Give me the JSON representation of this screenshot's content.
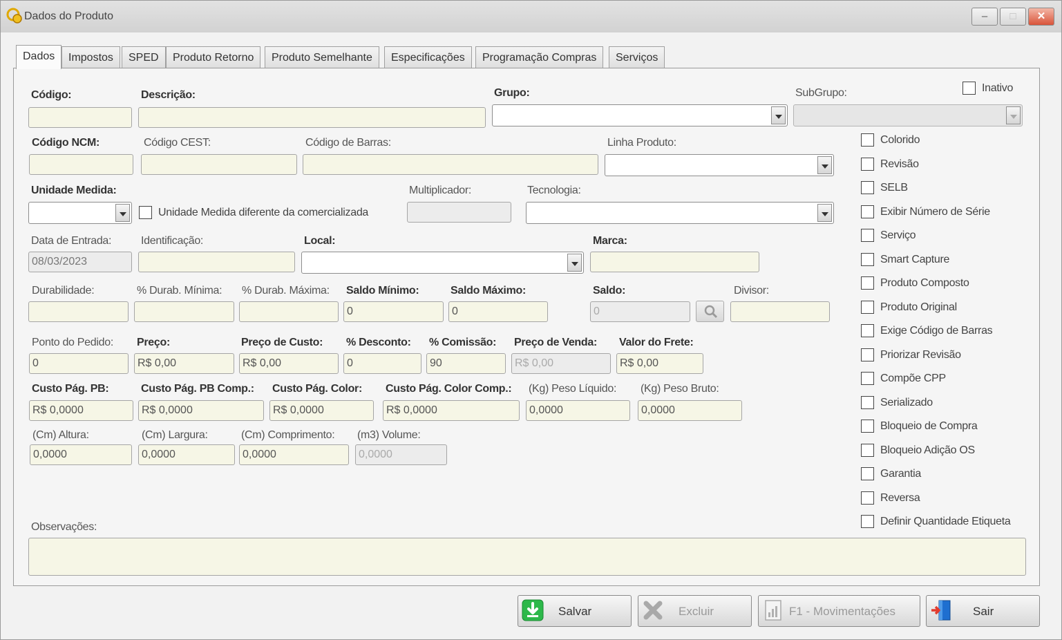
{
  "window": {
    "title": "Dados do Produto",
    "minimize": "–",
    "maximize": "□",
    "close": "✕"
  },
  "tabs": [
    "Dados",
    "Impostos",
    "SPED",
    "Produto Retorno",
    "Produto Semelhante",
    "Especificações",
    "Programação Compras",
    "Serviços"
  ],
  "form": {
    "codigo": {
      "label": "Código:",
      "value": ""
    },
    "descricao": {
      "label": "Descrição:",
      "value": ""
    },
    "grupo": {
      "label": "Grupo:",
      "value": ""
    },
    "subgrupo": {
      "label": "SubGrupo:",
      "value": ""
    },
    "inativo": {
      "label": "Inativo",
      "checked": false
    },
    "codigo_ncm": {
      "label": "Código NCM:",
      "value": ""
    },
    "codigo_cest": {
      "label": "Código CEST:",
      "value": ""
    },
    "codigo_barras": {
      "label": "Código de Barras:",
      "value": ""
    },
    "linha_produto": {
      "label": "Linha Produto:",
      "value": ""
    },
    "unidade_medida": {
      "label": "Unidade Medida:",
      "value": ""
    },
    "unidade_diferente": {
      "label": "Unidade Medida diferente da comercializada",
      "checked": false
    },
    "multiplicador": {
      "label": "Multiplicador:",
      "value": ""
    },
    "tecnologia": {
      "label": "Tecnologia:",
      "value": ""
    },
    "data_entrada": {
      "label": "Data de Entrada:",
      "value": "08/03/2023"
    },
    "identificacao": {
      "label": "Identificação:",
      "value": ""
    },
    "local": {
      "label": "Local:",
      "value": ""
    },
    "marca": {
      "label": "Marca:",
      "value": ""
    },
    "durabilidade": {
      "label": "Durabilidade:",
      "value": ""
    },
    "durab_minima": {
      "label": "% Durab. Mínima:",
      "value": ""
    },
    "durab_maxima": {
      "label": "% Durab. Máxima:",
      "value": ""
    },
    "saldo_minimo": {
      "label": "Saldo Mínimo:",
      "value": "0"
    },
    "saldo_maximo": {
      "label": "Saldo Máximo:",
      "value": "0"
    },
    "saldo": {
      "label": "Saldo:",
      "value": "0"
    },
    "divisor": {
      "label": "Divisor:",
      "value": ""
    },
    "ponto_pedido": {
      "label": "Ponto do Pedido:",
      "value": "0"
    },
    "preco": {
      "label": "Preço:",
      "value": "R$ 0,00"
    },
    "preco_custo": {
      "label": "Preço de Custo:",
      "value": "R$ 0,00"
    },
    "desconto": {
      "label": "% Desconto:",
      "value": "0"
    },
    "comissao": {
      "label": "% Comissão:",
      "value": "90"
    },
    "preco_venda": {
      "label": "Preço de Venda:",
      "value": "R$ 0,00"
    },
    "valor_frete": {
      "label": "Valor do Frete:",
      "value": "R$ 0,00"
    },
    "custo_pb": {
      "label": "Custo Pág. PB:",
      "value": "R$ 0,0000"
    },
    "custo_pb_comp": {
      "label": "Custo Pág. PB Comp.:",
      "value": "R$ 0,0000"
    },
    "custo_color": {
      "label": "Custo Pág. Color:",
      "value": "R$ 0,0000"
    },
    "custo_color_comp": {
      "label": "Custo Pág. Color Comp.:",
      "value": "R$ 0,0000"
    },
    "peso_liquido": {
      "label": "(Kg) Peso Líquido:",
      "value": "0,0000"
    },
    "peso_bruto": {
      "label": "(Kg) Peso Bruto:",
      "value": "0,0000"
    },
    "altura": {
      "label": "(Cm) Altura:",
      "value": "0,0000"
    },
    "largura": {
      "label": "(Cm) Largura:",
      "value": "0,0000"
    },
    "comprimento": {
      "label": "(Cm) Comprimento:",
      "value": "0,0000"
    },
    "volume": {
      "label": "(m3) Volume:",
      "value": "0,0000"
    },
    "observacoes": {
      "label": "Observações:",
      "value": ""
    }
  },
  "options": [
    "Colorido",
    "Revisão",
    "SELB",
    "Exibir Número de Série",
    "Serviço",
    "Smart Capture",
    "Produto Composto",
    "Produto Original",
    "Exige Código de Barras",
    "Priorizar Revisão",
    "Compõe CPP",
    "Serializado",
    "Bloqueio de Compra",
    "Bloqueio Adição OS",
    "Garantia",
    "Reversa",
    "Definir Quantidade Etiqueta"
  ],
  "buttons": {
    "salvar": "Salvar",
    "excluir": "Excluir",
    "movimentacoes": "F1 - Movimentações",
    "sair": "Sair"
  },
  "colors": {
    "field_bg": "#f6f6e6",
    "accent_green": "#2db84a",
    "accent_blue": "#1e6fd0"
  }
}
